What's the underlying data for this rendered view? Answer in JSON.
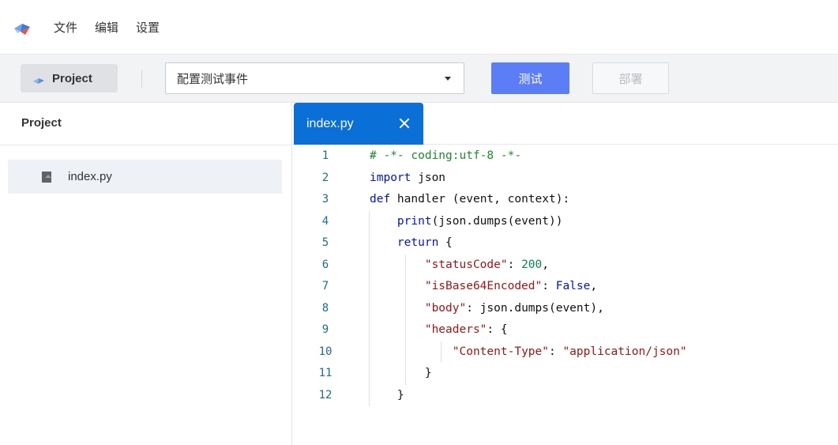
{
  "menubar": {
    "items": [
      {
        "label": "文件"
      },
      {
        "label": "编辑"
      },
      {
        "label": "设置"
      }
    ]
  },
  "toolbar": {
    "project_label": "Project",
    "event_select_value": "配置测试事件",
    "test_label": "测试",
    "deploy_label": "部署"
  },
  "sidebar": {
    "header": "Project",
    "files": [
      {
        "name": "index.py",
        "icon": "file-icon"
      }
    ]
  },
  "editor": {
    "tab_label": "index.py",
    "code_lines": [
      {
        "n": "1",
        "text": "# -*- coding:utf-8 -*-"
      },
      {
        "n": "2",
        "text": "import json"
      },
      {
        "n": "3",
        "text": "def handler (event, context):"
      },
      {
        "n": "4",
        "text": "    print(json.dumps(event))"
      },
      {
        "n": "5",
        "text": "    return {"
      },
      {
        "n": "6",
        "text": "        \"statusCode\": 200,"
      },
      {
        "n": "7",
        "text": "        \"isBase64Encoded\": False,"
      },
      {
        "n": "8",
        "text": "        \"body\": json.dumps(event),"
      },
      {
        "n": "9",
        "text": "        \"headers\": {"
      },
      {
        "n": "10",
        "text": "            \"Content-Type\": \"application/json\""
      },
      {
        "n": "11",
        "text": "        }"
      },
      {
        "n": "12",
        "text": "    }"
      }
    ]
  },
  "colors": {
    "accent": "#5b7ef7",
    "tab_active": "#0b6fd8",
    "comment": "#1c8b2a",
    "keyword": "#0014c8",
    "string": "#a31515",
    "number": "#098658"
  }
}
